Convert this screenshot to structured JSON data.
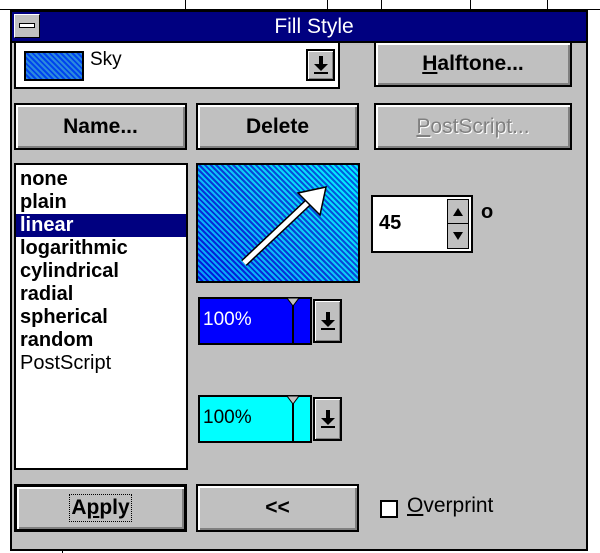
{
  "window": {
    "title": "Fill Style"
  },
  "fill_combo": {
    "value": "Sky"
  },
  "buttons": {
    "halftone": {
      "accel": "H",
      "rest": "alftone..."
    },
    "name": "Name...",
    "delete": "Delete",
    "postscript": {
      "accel": "P",
      "rest": "ostScript..."
    },
    "apply": {
      "prefix": "A",
      "accel": "p",
      "rest": "ply"
    },
    "collapse": "<<"
  },
  "fill_types": {
    "items": [
      "none",
      "plain",
      "linear",
      "logarithmic",
      "cylindrical",
      "radial",
      "spherical",
      "random",
      "PostScript"
    ],
    "selected": "linear"
  },
  "angle": {
    "value": "45",
    "unit": "o"
  },
  "start_color": {
    "percent": "100%",
    "color": "#0000ff"
  },
  "end_color": {
    "percent": "100%",
    "color": "#00ffff"
  },
  "overprint": {
    "accel": "O",
    "rest": "verprint",
    "checked": false
  },
  "icons": {
    "system_menu": "system-menu-icon",
    "dropdown": "dropdown-arrow-icon",
    "spin_up": "up-triangle-icon",
    "spin_down": "down-triangle-icon",
    "direction": "diagonal-arrow-icon"
  }
}
